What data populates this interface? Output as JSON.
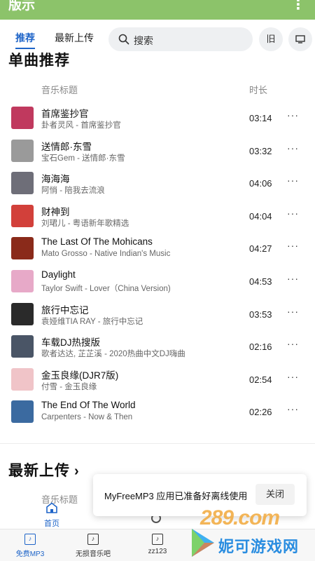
{
  "app": {
    "title": "版示",
    "more_icon": "more-vertical-icon"
  },
  "nav": {
    "tabs": [
      {
        "label": "推荐",
        "active": true
      },
      {
        "label": "最新上传",
        "active": false
      }
    ],
    "search_placeholder": "搜索",
    "old_button": "旧",
    "tv_icon": "tv-icon"
  },
  "sections": {
    "recommend_title": "单曲推荐",
    "latest_title": "最新上传"
  },
  "columns": {
    "title": "音乐标题",
    "duration": "时长"
  },
  "songs": [
    {
      "title": "首席鉴抄官",
      "subtitle": "卦者灵风 - 首席鉴抄官",
      "duration": "03:14",
      "cover": "#c0395e"
    },
    {
      "title": "送情郎·东雪",
      "subtitle": "宝石Gem - 送情郎·东雪",
      "duration": "03:32",
      "cover": "#9a9a9a"
    },
    {
      "title": "海海海",
      "subtitle": "阿悄 - 陪我去流浪",
      "duration": "04:06",
      "cover": "#6e6e78"
    },
    {
      "title": "财神到",
      "subtitle": "刘珺儿 - 粤语新年歌精选",
      "duration": "04:04",
      "cover": "#d2403a"
    },
    {
      "title": "The Last Of The Mohicans",
      "subtitle": "Mato Grosso - Native Indian's Music",
      "duration": "04:27",
      "cover": "#8a2a1a"
    },
    {
      "title": "Daylight",
      "subtitle": "Taylor Swift - Lover（China Version)",
      "duration": "04:53",
      "cover": "#e7a9c8"
    },
    {
      "title": "旅行中忘记",
      "subtitle": "袁娅维TIA RAY - 旅行中忘记",
      "duration": "03:53",
      "cover": "#2a2a2a"
    },
    {
      "title": "车载DJ热搜版",
      "subtitle": "歌者达达, 芷芷溪 - 2020热曲中文DJ嗨曲",
      "duration": "02:16",
      "cover": "#4a5566"
    },
    {
      "title": "金玉良缘(DJR7版)",
      "subtitle": "付雪 - 金玉良缘",
      "duration": "02:54",
      "cover": "#f0c4c8"
    },
    {
      "title": "The End Of The World",
      "subtitle": "Carpenters - Now & Then",
      "duration": "02:26",
      "cover": "#3b6aa0"
    }
  ],
  "more_label": "···",
  "toast": {
    "message": "MyFreeMP3 应用已准备好离线使用",
    "close_label": "关闭"
  },
  "home": {
    "label": "首页",
    "icon": "home-icon"
  },
  "bottom_nav": [
    {
      "label": "免费MP3",
      "icon": "music-note-icon",
      "active": true
    },
    {
      "label": "无损音乐吧",
      "icon": "music-note-icon",
      "active": false
    },
    {
      "label": "zz123",
      "icon": "music-note-icon",
      "active": false
    }
  ],
  "watermark": {
    "number": "289.com",
    "text": "妮可游戏网"
  },
  "colors": {
    "topbar": "#8cc36a",
    "accent": "#1e64c8"
  }
}
